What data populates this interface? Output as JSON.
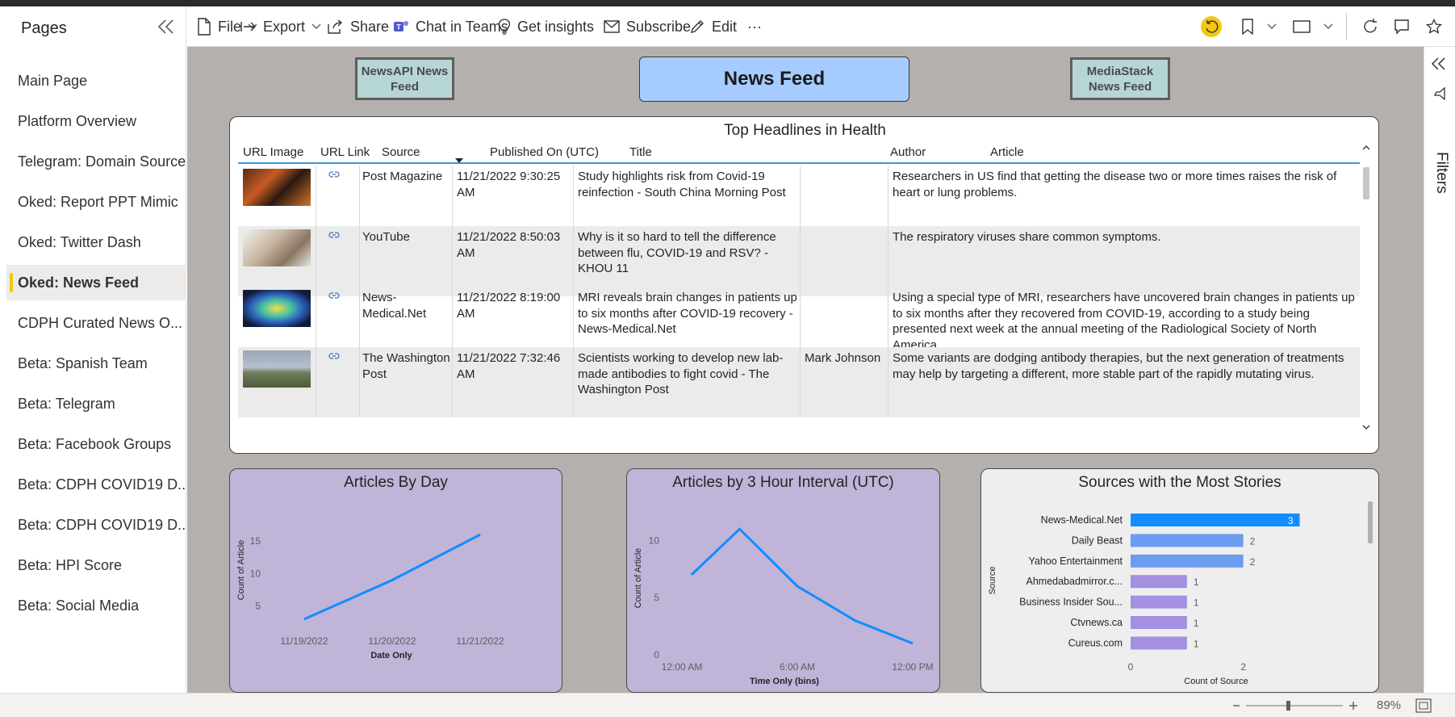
{
  "pages_pane": {
    "title": "Pages",
    "items": [
      {
        "label": "Main Page"
      },
      {
        "label": "Platform Overview"
      },
      {
        "label": "Telegram: Domain Source"
      },
      {
        "label": "Oked: Report PPT Mimic"
      },
      {
        "label": "Oked: Twitter Dash"
      },
      {
        "label": "Oked: News Feed",
        "active": true
      },
      {
        "label": "CDPH Curated News O..."
      },
      {
        "label": "Beta: Spanish Team"
      },
      {
        "label": "Beta: Telegram"
      },
      {
        "label": "Beta: Facebook Groups"
      },
      {
        "label": "Beta: CDPH COVID19 D..."
      },
      {
        "label": "Beta: CDPH COVID19 D..."
      },
      {
        "label": "Beta: HPI Score"
      },
      {
        "label": "Beta: Social Media"
      }
    ]
  },
  "toolbar": {
    "file": "File",
    "export": "Export",
    "share": "Share",
    "chat_in_teams": "Chat in Teams",
    "get_insights": "Get insights",
    "subscribe": "Subscribe",
    "edit": "Edit",
    "more": "···"
  },
  "filters": {
    "label": "Filters"
  },
  "report": {
    "nav_left": "NewsAPI News Feed",
    "title": "News Feed",
    "nav_right": "MediaStack News Feed"
  },
  "table": {
    "title": "Top Headlines in Health",
    "columns": [
      "URL Image",
      "URL Link",
      "Source",
      "Published On (UTC)",
      "Title",
      "Author",
      "Article"
    ],
    "rows": [
      {
        "source": "Post Magazine",
        "published": "11/21/2022 9:30:25 AM",
        "title": "Study highlights risk from Covid-19 reinfection - South China Morning Post",
        "author": "",
        "article": "Researchers in US find that getting the disease two or more times raises the risk of heart or lung problems."
      },
      {
        "source": "YouTube",
        "published": "11/21/2022 8:50:03 AM",
        "title": "Why is it so hard to tell the difference between flu, COVID-19 and RSV? - KHOU 11",
        "author": "",
        "article": "The respiratory viruses share common symptoms."
      },
      {
        "source": "News-Medical.Net",
        "published": "11/21/2022 8:19:00 AM",
        "title": "MRI reveals brain changes in patients up to six months after COVID-19 recovery - News-Medical.Net",
        "author": "",
        "article": "Using a special type of MRI, researchers have uncovered brain changes in patients up to six months after they recovered from COVID-19, according to a study being presented next week at the annual meeting of the Radiological Society of North America."
      },
      {
        "source": "The Washington Post",
        "published": "11/21/2022 7:32:46 AM",
        "title": "Scientists working to develop new lab-made antibodies to fight covid - The Washington Post",
        "author": "Mark Johnson",
        "article": "Some variants are dodging antibody therapies, but the next generation of treatments may help by targeting a different, more stable part of the rapidly mutating virus."
      }
    ]
  },
  "chart_data": [
    {
      "type": "line",
      "title": "Articles By Day",
      "xlabel": "Date Only",
      "ylabel": "Count of Article",
      "categories": [
        "11/19/2022",
        "11/20/2022",
        "11/21/2022"
      ],
      "values": [
        3,
        9,
        16
      ],
      "yticks": [
        5,
        10,
        15
      ],
      "ylim": [
        0,
        18
      ],
      "color": "#118dff"
    },
    {
      "type": "line",
      "title": "Articles by 3 Hour Interval (UTC)",
      "xlabel": "Time Only (bins)",
      "ylabel": "Count of Article",
      "x_tick_labels": [
        "12:00 AM",
        "6:00 AM",
        "12:00 PM"
      ],
      "x_hours": [
        3,
        6,
        9,
        12,
        15,
        18,
        21
      ],
      "values": [
        7,
        11,
        6,
        3,
        1
      ],
      "x_values_hours": [
        0.5,
        3,
        6,
        9,
        12
      ],
      "yticks": [
        0,
        5,
        10
      ],
      "ylim": [
        0,
        12
      ],
      "xlim": [
        0,
        12
      ],
      "color": "#118dff"
    },
    {
      "type": "bar",
      "orientation": "horizontal",
      "title": "Sources with the Most Stories",
      "xlabel": "Count of Source",
      "ylabel": "Source",
      "categories": [
        "News-Medical.Net",
        "Daily Beast",
        "Yahoo Entertainment",
        "Ahmedabadmirror.c...",
        "Business Insider Sou...",
        "Ctvnews.ca",
        "Cureus.com"
      ],
      "values": [
        3,
        2,
        2,
        1,
        1,
        1,
        1
      ],
      "xticks": [
        0,
        2
      ],
      "xlim": [
        0,
        3.05
      ],
      "colors": [
        "#118dff",
        "#6b9cf0",
        "#6b9cf0",
        "#a48fe0",
        "#a48fe0",
        "#a48fe0",
        "#a48fe0"
      ]
    }
  ],
  "status": {
    "zoom": "89%"
  }
}
